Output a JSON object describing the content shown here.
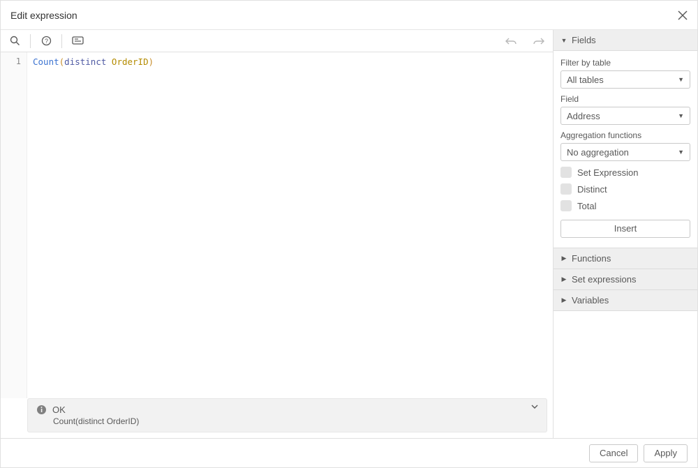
{
  "header": {
    "title": "Edit expression"
  },
  "toolbar": {
    "search_icon": "search-icon",
    "help_icon": "help-icon",
    "comment_icon": "comment-icon",
    "undo_icon": "undo-icon",
    "redo_icon": "redo-icon"
  },
  "editor": {
    "line_number": "1",
    "tokens": {
      "func": "Count",
      "open": "(",
      "kw": "distinct",
      "id": "OrderID",
      "close": ")"
    }
  },
  "status": {
    "label": "OK",
    "expression": "Count(distinct OrderID)"
  },
  "panel": {
    "fields": {
      "title": "Fields",
      "filter_label": "Filter by table",
      "filter_value": "All tables",
      "field_label": "Field",
      "field_value": "Address",
      "agg_label": "Aggregation functions",
      "agg_value": "No aggregation",
      "set_expression": "Set Expression",
      "distinct": "Distinct",
      "total": "Total",
      "insert": "Insert"
    },
    "functions": {
      "title": "Functions"
    },
    "set_expressions": {
      "title": "Set expressions"
    },
    "variables": {
      "title": "Variables"
    }
  },
  "footer": {
    "cancel": "Cancel",
    "apply": "Apply"
  }
}
